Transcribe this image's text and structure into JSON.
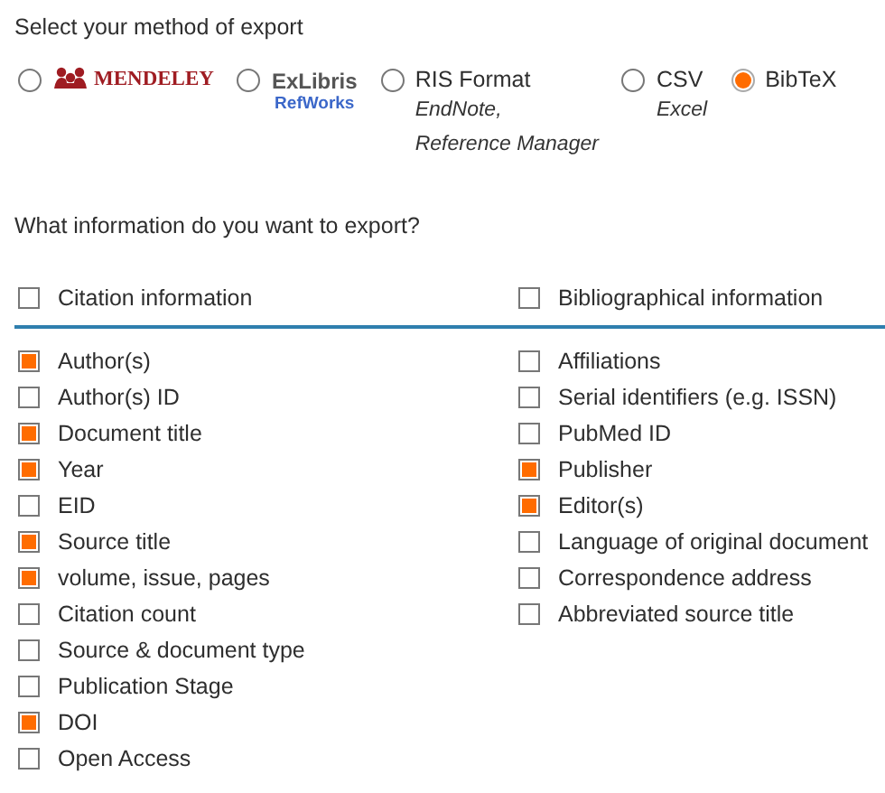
{
  "export_method": {
    "heading": "Select your method of export",
    "options": [
      {
        "kind": "mendeley",
        "label": "MENDELEY",
        "selected": false
      },
      {
        "kind": "exlibris",
        "label": "ExLibris",
        "sublabel": "RefWorks",
        "selected": false
      },
      {
        "kind": "text",
        "label": "RIS Format",
        "notes": [
          "EndNote,",
          "Reference Manager"
        ],
        "selected": false
      },
      {
        "kind": "text",
        "label": "CSV",
        "notes": [
          "Excel"
        ],
        "selected": false
      },
      {
        "kind": "text",
        "label": "BibTeX",
        "selected": true
      }
    ]
  },
  "export_info": {
    "heading": "What information do you want to export?",
    "groups": [
      {
        "label": "Citation information",
        "checked": false,
        "items": [
          {
            "label": "Author(s)",
            "checked": true
          },
          {
            "label": "Author(s) ID",
            "checked": false
          },
          {
            "label": "Document title",
            "checked": true
          },
          {
            "label": "Year",
            "checked": true
          },
          {
            "label": "EID",
            "checked": false
          },
          {
            "label": "Source title",
            "checked": true
          },
          {
            "label": "volume, issue, pages",
            "checked": true
          },
          {
            "label": "Citation count",
            "checked": false
          },
          {
            "label": "Source & document type",
            "checked": false
          },
          {
            "label": "Publication Stage",
            "checked": false
          },
          {
            "label": "DOI",
            "checked": true
          },
          {
            "label": "Open Access",
            "checked": false
          }
        ]
      },
      {
        "label": "Bibliographical information",
        "checked": false,
        "items": [
          {
            "label": "Affiliations",
            "checked": false
          },
          {
            "label": "Serial identifiers (e.g. ISSN)",
            "checked": false
          },
          {
            "label": "PubMed ID",
            "checked": false
          },
          {
            "label": "Publisher",
            "checked": true
          },
          {
            "label": "Editor(s)",
            "checked": true
          },
          {
            "label": "Language of original document",
            "checked": false
          },
          {
            "label": "Correspondence address",
            "checked": false
          },
          {
            "label": "Abbreviated source title",
            "checked": false
          }
        ]
      }
    ]
  }
}
